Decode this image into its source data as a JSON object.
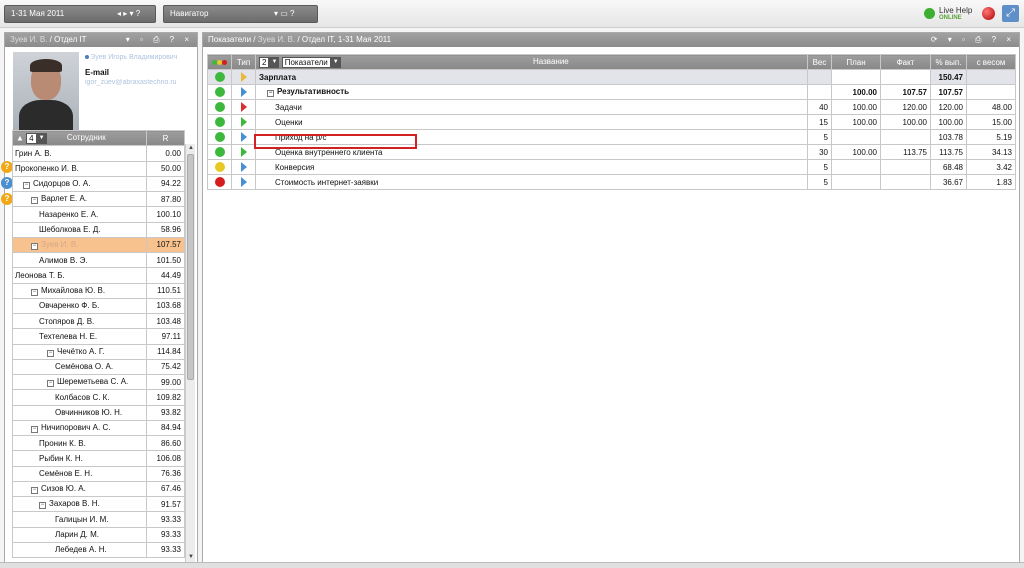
{
  "topbar": {
    "period": "1-31 Мая 2011",
    "period_controls": "◂ ▸ ▾ ?",
    "navigator": "Навигатор",
    "navigator_controls": "▾ ▭ ?",
    "livehelp_line1": "Live Help",
    "livehelp_line2": "ONLINE",
    "exit_icon": "logout-icon"
  },
  "left_panel": {
    "title_blur": "Зуев И. В.",
    "title": " / Отдел IT",
    "tools": "▾ ▫ ⎙ ? ×",
    "profile": {
      "name_blur": "Зуев Игорь Владимирович",
      "email_label": "E-mail",
      "email_blur": "igor_zuev@abraxastechno.ru"
    },
    "side_icons": [
      "?",
      "?",
      "?"
    ],
    "table": {
      "count": "4",
      "col_employee": "Сотрудник",
      "col_r": "R",
      "sort_icon": "▲",
      "rows": [
        {
          "name": "Грин А. В.",
          "r": "0.00",
          "indent": 0,
          "tree": ""
        },
        {
          "name": "Прокопенко И. В.",
          "r": "50.00",
          "indent": 0,
          "tree": ""
        },
        {
          "name": "Сидорцов О. А.",
          "r": "94.22",
          "indent": 1,
          "tree": "⊟"
        },
        {
          "name": "Варлет Е. А.",
          "r": "87.80",
          "indent": 2,
          "tree": "⊟"
        },
        {
          "name": "Назаренко Е. А.",
          "r": "100.10",
          "indent": 3,
          "tree": ""
        },
        {
          "name": "Шеболкова Е. Д.",
          "r": "58.96",
          "indent": 3,
          "tree": ""
        },
        {
          "name": "Зуев И. В.",
          "r": "107.57",
          "indent": 2,
          "tree": "⊟",
          "selected": true
        },
        {
          "name": "Алимов В. Э.",
          "r": "101.50",
          "indent": 3,
          "tree": ""
        },
        {
          "name": "Леонова Т. Б.",
          "r": "44.49",
          "indent": 0,
          "tree": ""
        },
        {
          "name": "Михайлова Ю. В.",
          "r": "110.51",
          "indent": 2,
          "tree": "⊟"
        },
        {
          "name": "Овчаренко Ф. Б.",
          "r": "103.68",
          "indent": 3,
          "tree": ""
        },
        {
          "name": "Стопяров Д. В.",
          "r": "103.48",
          "indent": 3,
          "tree": ""
        },
        {
          "name": "Техтелева Н. Е.",
          "r": "97.11",
          "indent": 3,
          "tree": ""
        },
        {
          "name": "Чечётко А. Г.",
          "r": "114.84",
          "indent": 4,
          "tree": "⊟"
        },
        {
          "name": "Семёнова О. А.",
          "r": "75.42",
          "indent": 5,
          "tree": ""
        },
        {
          "name": "Шереметьева С. А.",
          "r": "99.00",
          "indent": 4,
          "tree": "⊟"
        },
        {
          "name": "Колбасов С. К.",
          "r": "109.82",
          "indent": 5,
          "tree": ""
        },
        {
          "name": "Овчинников Ю. Н.",
          "r": "93.82",
          "indent": 5,
          "tree": ""
        },
        {
          "name": "Ничипорович А. С.",
          "r": "84.94",
          "indent": 2,
          "tree": "⊟"
        },
        {
          "name": "Пронин К. В.",
          "r": "86.60",
          "indent": 3,
          "tree": ""
        },
        {
          "name": "Рыбин К. Н.",
          "r": "106.08",
          "indent": 3,
          "tree": ""
        },
        {
          "name": "Семёнов Е. Н.",
          "r": "76.36",
          "indent": 3,
          "tree": ""
        },
        {
          "name": "Сизов Ю. А.",
          "r": "67.46",
          "indent": 2,
          "tree": "⊟"
        },
        {
          "name": "Захаров В. Н.",
          "r": "91.57",
          "indent": 3,
          "tree": "⊟"
        },
        {
          "name": "Галицын И. М.",
          "r": "93.33",
          "indent": 5,
          "tree": ""
        },
        {
          "name": "Ларин Д. М.",
          "r": "93.33",
          "indent": 5,
          "tree": ""
        },
        {
          "name": "Лебедев А. Н.",
          "r": "93.33",
          "indent": 5,
          "tree": ""
        }
      ]
    }
  },
  "right_panel": {
    "title_prefix": "Показатели / ",
    "title_blur": "Зуев И. В.",
    "title_suffix": " / Отдел IT, 1-31 Мая 2011",
    "tools": "⟳ ▾ ▫ ⎙ ? ×",
    "table": {
      "level": "2",
      "level_select": "Показатели",
      "col_type": "Тип",
      "col_name": "Название",
      "col_weight": "Вес",
      "col_plan": "План",
      "col_fact": "Факт",
      "col_pct": "% вып.",
      "col_weighted": "с весом",
      "rows": [
        {
          "status": "#3db83d",
          "flag": "#e8b93a",
          "name": "Зарплата",
          "weight": "",
          "plan": "",
          "fact": "",
          "pct": "150.47",
          "weighted": "",
          "group": true,
          "bold": true,
          "tree": "",
          "indent": 0
        },
        {
          "status": "#3db83d",
          "flag": "#4a8fd0",
          "name": "Результативность",
          "weight": "",
          "plan": "100.00",
          "fact": "107.57",
          "pct": "107.57",
          "weighted": "",
          "group": false,
          "bold": true,
          "tree": "⊟",
          "indent": 1
        },
        {
          "status": "#3db83d",
          "flag": "#d93030",
          "name": "Задачи",
          "weight": "40",
          "plan": "100.00",
          "fact": "120.00",
          "pct": "120.00",
          "weighted": "48.00",
          "group": false,
          "bold": false,
          "tree": "",
          "indent": 2
        },
        {
          "status": "#3db83d",
          "flag": "#3db83d",
          "name": "Оценки",
          "weight": "15",
          "plan": "100.00",
          "fact": "100.00",
          "pct": "100.00",
          "weighted": "15.00",
          "group": false,
          "bold": false,
          "tree": "",
          "indent": 2
        },
        {
          "status": "#3db83d",
          "flag": "#4a8fd0",
          "name": "Приход на р/с",
          "weight": "5",
          "plan": "",
          "fact": "",
          "pct": "103.78",
          "weighted": "5.19",
          "group": false,
          "bold": false,
          "tree": "",
          "indent": 2
        },
        {
          "status": "#3db83d",
          "flag": "#3db83d",
          "name": "Оценка внутреннего клиента",
          "weight": "30",
          "plan": "100.00",
          "fact": "113.75",
          "pct": "113.75",
          "weighted": "34.13",
          "group": false,
          "bold": false,
          "tree": "",
          "indent": 2
        },
        {
          "status": "#e8c824",
          "flag": "#4a8fd0",
          "name": "Конверсия",
          "weight": "5",
          "plan": "",
          "fact": "",
          "pct": "68.48",
          "weighted": "3.42",
          "group": false,
          "bold": false,
          "tree": "",
          "indent": 2
        },
        {
          "status": "#d61c1c",
          "flag": "#4a8fd0",
          "name": "Стоимость интернет-заявки",
          "weight": "5",
          "plan": "",
          "fact": "",
          "pct": "36.67",
          "weighted": "1.83",
          "group": false,
          "bold": false,
          "tree": "",
          "indent": 2
        }
      ]
    }
  }
}
